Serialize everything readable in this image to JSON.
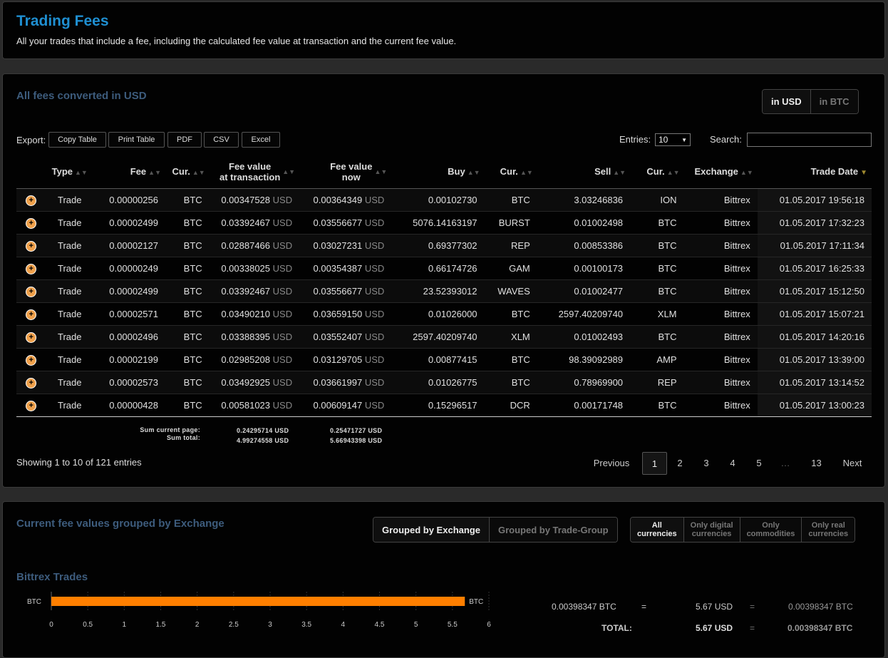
{
  "header": {
    "title": "Trading Fees",
    "subtitle": "All your trades that include a fee, including the calculated fee value at transaction and the current fee value."
  },
  "fees": {
    "title": "All fees converted in USD",
    "currency_toggle": [
      "in USD",
      "in BTC"
    ],
    "export_label": "Export:",
    "export_buttons": [
      "Copy Table",
      "Print Table",
      "PDF",
      "CSV",
      "Excel"
    ],
    "entries_label": "Entries:",
    "entries_value": "10",
    "search_label": "Search:",
    "search_value": "",
    "columns": [
      "Type",
      "Fee",
      "Cur.",
      "Fee value at transaction",
      "Fee value now",
      "Buy",
      "Cur.",
      "Sell",
      "Cur.",
      "Exchange",
      "Trade Date"
    ],
    "col_fee_tx_l1": "Fee value",
    "col_fee_tx_l2": "at transaction",
    "col_fee_now_l1": "Fee value",
    "col_fee_now_l2": "now",
    "unit": "USD",
    "rows": [
      [
        "Trade",
        "0.00000256",
        "BTC",
        "0.00347528",
        "0.00364349",
        "0.00102730",
        "BTC",
        "3.03246836",
        "ION",
        "Bittrex",
        "01.05.2017 19:56:18"
      ],
      [
        "Trade",
        "0.00002499",
        "BTC",
        "0.03392467",
        "0.03556677",
        "5076.14163197",
        "BURST",
        "0.01002498",
        "BTC",
        "Bittrex",
        "01.05.2017 17:32:23"
      ],
      [
        "Trade",
        "0.00002127",
        "BTC",
        "0.02887466",
        "0.03027231",
        "0.69377302",
        "REP",
        "0.00853386",
        "BTC",
        "Bittrex",
        "01.05.2017 17:11:34"
      ],
      [
        "Trade",
        "0.00000249",
        "BTC",
        "0.00338025",
        "0.00354387",
        "0.66174726",
        "GAM",
        "0.00100173",
        "BTC",
        "Bittrex",
        "01.05.2017 16:25:33"
      ],
      [
        "Trade",
        "0.00002499",
        "BTC",
        "0.03392467",
        "0.03556677",
        "23.52393012",
        "WAVES",
        "0.01002477",
        "BTC",
        "Bittrex",
        "01.05.2017 15:12:50"
      ],
      [
        "Trade",
        "0.00002571",
        "BTC",
        "0.03490210",
        "0.03659150",
        "0.01026000",
        "BTC",
        "2597.40209740",
        "XLM",
        "Bittrex",
        "01.05.2017 15:07:21"
      ],
      [
        "Trade",
        "0.00002496",
        "BTC",
        "0.03388395",
        "0.03552407",
        "2597.40209740",
        "XLM",
        "0.01002493",
        "BTC",
        "Bittrex",
        "01.05.2017 14:20:16"
      ],
      [
        "Trade",
        "0.00002199",
        "BTC",
        "0.02985208",
        "0.03129705",
        "0.00877415",
        "BTC",
        "98.39092989",
        "AMP",
        "Bittrex",
        "01.05.2017 13:39:00"
      ],
      [
        "Trade",
        "0.00002573",
        "BTC",
        "0.03492925",
        "0.03661997",
        "0.01026775",
        "BTC",
        "0.78969900",
        "REP",
        "Bittrex",
        "01.05.2017 13:14:52"
      ],
      [
        "Trade",
        "0.00000428",
        "BTC",
        "0.00581023",
        "0.00609147",
        "0.15296517",
        "DCR",
        "0.00171748",
        "BTC",
        "Bittrex",
        "01.05.2017 13:00:23"
      ]
    ],
    "sum_page_label": "Sum current page:",
    "sum_total_label": "Sum total:",
    "sum_page_tx": "0.24295714 USD",
    "sum_page_now": "0.25471727 USD",
    "sum_total_tx": "4.99274558 USD",
    "sum_total_now": "5.66943398 USD",
    "showing": "Showing 1 to 10 of 121 entries",
    "pagination": [
      "Previous",
      "1",
      "2",
      "3",
      "4",
      "5",
      "…",
      "13",
      "Next"
    ],
    "current_page": "1"
  },
  "grouped": {
    "title": "Current fee values grouped by Exchange",
    "group_toggle": [
      "Grouped by Exchange",
      "Grouped by Trade-Group"
    ],
    "filter_toggle": [
      {
        "l1": "All",
        "l2": "currencies"
      },
      {
        "l1": "Only digital",
        "l2": "currencies"
      },
      {
        "l1": "Only",
        "l2": "commodities"
      },
      {
        "l1": "Only real",
        "l2": "currencies"
      }
    ],
    "exchange_title": "Bittrex Trades",
    "chart_data": {
      "type": "bar",
      "orientation": "horizontal",
      "categories": [
        "BTC"
      ],
      "values": [
        5.67
      ],
      "value_label": "BTC",
      "xlim": [
        0,
        6
      ],
      "xticks": [
        "0",
        "0.5",
        "1",
        "1.5",
        "2",
        "2.5",
        "3",
        "3.5",
        "4",
        "4.5",
        "5",
        "5.5",
        "6"
      ],
      "bar_color": "#ff7f00"
    },
    "summary": {
      "btc": "0.00398347 BTC",
      "eq1": "=",
      "usd": "5.67 USD",
      "eq2": "=",
      "btc2": "0.00398347 BTC",
      "total_label": "TOTAL:",
      "total_usd": "5.67 USD",
      "total_eq": "=",
      "total_btc": "0.00398347 BTC"
    }
  }
}
